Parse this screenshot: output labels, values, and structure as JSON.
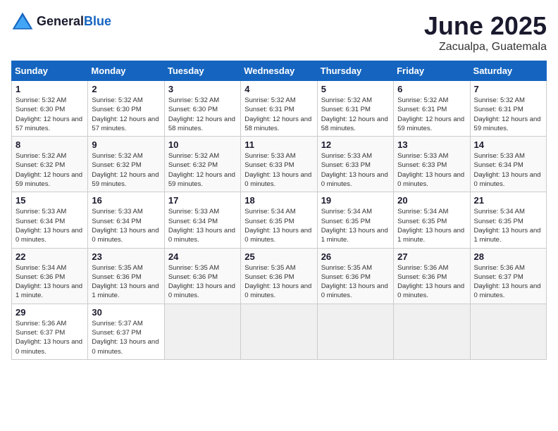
{
  "logo": {
    "general": "General",
    "blue": "Blue"
  },
  "header": {
    "month": "June 2025",
    "location": "Zacualpa, Guatemala"
  },
  "weekdays": [
    "Sunday",
    "Monday",
    "Tuesday",
    "Wednesday",
    "Thursday",
    "Friday",
    "Saturday"
  ],
  "weeks": [
    [
      {
        "day": "1",
        "sunrise": "5:32 AM",
        "sunset": "6:30 PM",
        "daylight": "12 hours and 57 minutes."
      },
      {
        "day": "2",
        "sunrise": "5:32 AM",
        "sunset": "6:30 PM",
        "daylight": "12 hours and 57 minutes."
      },
      {
        "day": "3",
        "sunrise": "5:32 AM",
        "sunset": "6:30 PM",
        "daylight": "12 hours and 58 minutes."
      },
      {
        "day": "4",
        "sunrise": "5:32 AM",
        "sunset": "6:31 PM",
        "daylight": "12 hours and 58 minutes."
      },
      {
        "day": "5",
        "sunrise": "5:32 AM",
        "sunset": "6:31 PM",
        "daylight": "12 hours and 58 minutes."
      },
      {
        "day": "6",
        "sunrise": "5:32 AM",
        "sunset": "6:31 PM",
        "daylight": "12 hours and 59 minutes."
      },
      {
        "day": "7",
        "sunrise": "5:32 AM",
        "sunset": "6:31 PM",
        "daylight": "12 hours and 59 minutes."
      }
    ],
    [
      {
        "day": "8",
        "sunrise": "5:32 AM",
        "sunset": "6:32 PM",
        "daylight": "12 hours and 59 minutes."
      },
      {
        "day": "9",
        "sunrise": "5:32 AM",
        "sunset": "6:32 PM",
        "daylight": "12 hours and 59 minutes."
      },
      {
        "day": "10",
        "sunrise": "5:32 AM",
        "sunset": "6:32 PM",
        "daylight": "12 hours and 59 minutes."
      },
      {
        "day": "11",
        "sunrise": "5:33 AM",
        "sunset": "6:33 PM",
        "daylight": "13 hours and 0 minutes."
      },
      {
        "day": "12",
        "sunrise": "5:33 AM",
        "sunset": "6:33 PM",
        "daylight": "13 hours and 0 minutes."
      },
      {
        "day": "13",
        "sunrise": "5:33 AM",
        "sunset": "6:33 PM",
        "daylight": "13 hours and 0 minutes."
      },
      {
        "day": "14",
        "sunrise": "5:33 AM",
        "sunset": "6:34 PM",
        "daylight": "13 hours and 0 minutes."
      }
    ],
    [
      {
        "day": "15",
        "sunrise": "5:33 AM",
        "sunset": "6:34 PM",
        "daylight": "13 hours and 0 minutes."
      },
      {
        "day": "16",
        "sunrise": "5:33 AM",
        "sunset": "6:34 PM",
        "daylight": "13 hours and 0 minutes."
      },
      {
        "day": "17",
        "sunrise": "5:33 AM",
        "sunset": "6:34 PM",
        "daylight": "13 hours and 0 minutes."
      },
      {
        "day": "18",
        "sunrise": "5:34 AM",
        "sunset": "6:35 PM",
        "daylight": "13 hours and 0 minutes."
      },
      {
        "day": "19",
        "sunrise": "5:34 AM",
        "sunset": "6:35 PM",
        "daylight": "13 hours and 1 minute."
      },
      {
        "day": "20",
        "sunrise": "5:34 AM",
        "sunset": "6:35 PM",
        "daylight": "13 hours and 1 minute."
      },
      {
        "day": "21",
        "sunrise": "5:34 AM",
        "sunset": "6:35 PM",
        "daylight": "13 hours and 1 minute."
      }
    ],
    [
      {
        "day": "22",
        "sunrise": "5:34 AM",
        "sunset": "6:36 PM",
        "daylight": "13 hours and 1 minute."
      },
      {
        "day": "23",
        "sunrise": "5:35 AM",
        "sunset": "6:36 PM",
        "daylight": "13 hours and 1 minute."
      },
      {
        "day": "24",
        "sunrise": "5:35 AM",
        "sunset": "6:36 PM",
        "daylight": "13 hours and 0 minutes."
      },
      {
        "day": "25",
        "sunrise": "5:35 AM",
        "sunset": "6:36 PM",
        "daylight": "13 hours and 0 minutes."
      },
      {
        "day": "26",
        "sunrise": "5:35 AM",
        "sunset": "6:36 PM",
        "daylight": "13 hours and 0 minutes."
      },
      {
        "day": "27",
        "sunrise": "5:36 AM",
        "sunset": "6:36 PM",
        "daylight": "13 hours and 0 minutes."
      },
      {
        "day": "28",
        "sunrise": "5:36 AM",
        "sunset": "6:37 PM",
        "daylight": "13 hours and 0 minutes."
      }
    ],
    [
      {
        "day": "29",
        "sunrise": "5:36 AM",
        "sunset": "6:37 PM",
        "daylight": "13 hours and 0 minutes."
      },
      {
        "day": "30",
        "sunrise": "5:37 AM",
        "sunset": "6:37 PM",
        "daylight": "13 hours and 0 minutes."
      },
      null,
      null,
      null,
      null,
      null
    ]
  ]
}
